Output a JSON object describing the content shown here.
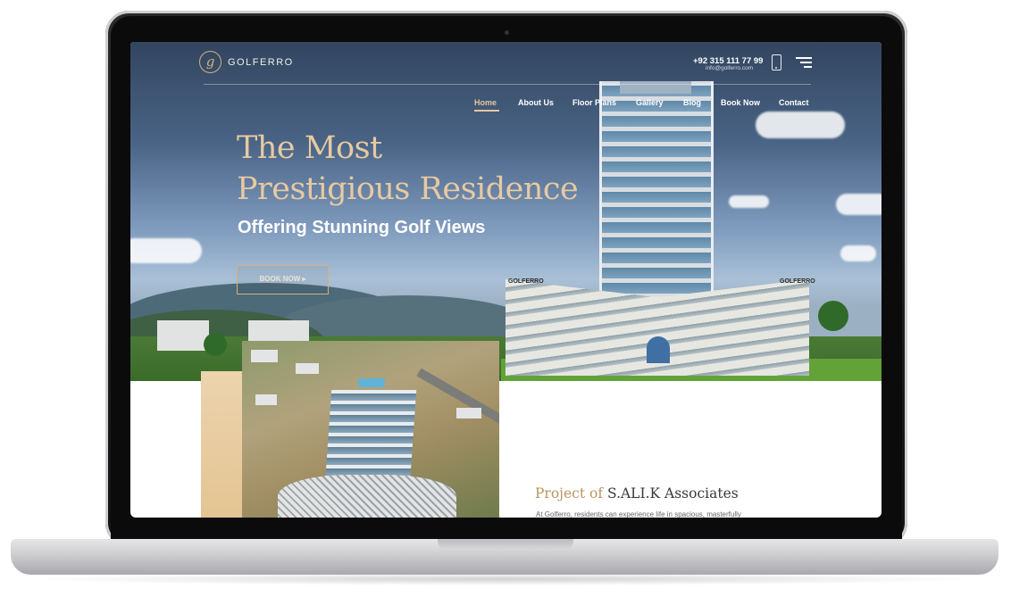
{
  "brand": {
    "name": "GOLFERRO",
    "accent_color": "#d7b07a"
  },
  "header": {
    "phone": "+92 315 111 77 99",
    "email": "info@golferro.com",
    "phone_icon": "mobile-phone-icon",
    "menu_icon": "hamburger-menu-icon"
  },
  "nav": {
    "items": [
      {
        "label": "Home",
        "active": true
      },
      {
        "label": "About Us"
      },
      {
        "label": "Floor Plans"
      },
      {
        "label": "Gallery"
      },
      {
        "label": "Blog"
      },
      {
        "label": "Book Now"
      },
      {
        "label": "Contact"
      }
    ]
  },
  "hero": {
    "title_line1": "The Most",
    "title_line2": "Prestigious Residence",
    "subtitle": "Offering Stunning Golf Views",
    "cta_label": "BOOK NOW ▸",
    "building_signs": [
      "GOLFERRO",
      "GOLFERRO"
    ]
  },
  "project": {
    "title_prefix": "Project of",
    "title_name": "S.ALI.K Associates",
    "text": "At Golferro, residents can experience life in spacious, masterfully"
  }
}
